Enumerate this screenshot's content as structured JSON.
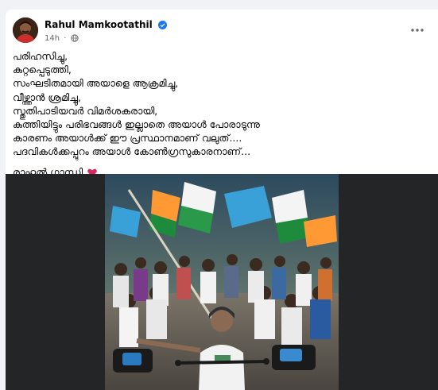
{
  "post": {
    "author": "Rahul Mamkootathil",
    "time": "14h",
    "separator": "·",
    "lines": [
      "പരിഹസിച്ചു,",
      "കുറ്റപ്പെടുത്തി,",
      "സംഘടിതമായി അയാളെ ആക്രമിച്ചു,",
      "വീഴ്ത്താൻ ശ്രമിച്ചു,",
      "സ്തുതിപാടിയവർ വിമർശകരായി,",
      "കുത്തിയിട്ടും പരിഭവങ്ങൾ ഇല്ലാതെ അയാൾ പോരാടുന്നു",
      "കാരണം അയാൾക്ക് ഈ പ്രസ്ഥാനമാണ് വലുത്....",
      "പദവികൾക്കപ്പുറം അയാൾ കോൺഗ്രസുകാരനാണ്..."
    ],
    "signature": "രാഹുൽ ഗാന്ധി",
    "icons": {
      "verified": "verified-badge-icon",
      "privacy": "globe-icon",
      "more": "more-options-icon",
      "emoji": "red-heart-icon"
    }
  },
  "colors": {
    "page_bg": "#f0f2f5",
    "verified": "#1877f2",
    "heart": "#e0245e",
    "media_bg": "#242526"
  }
}
